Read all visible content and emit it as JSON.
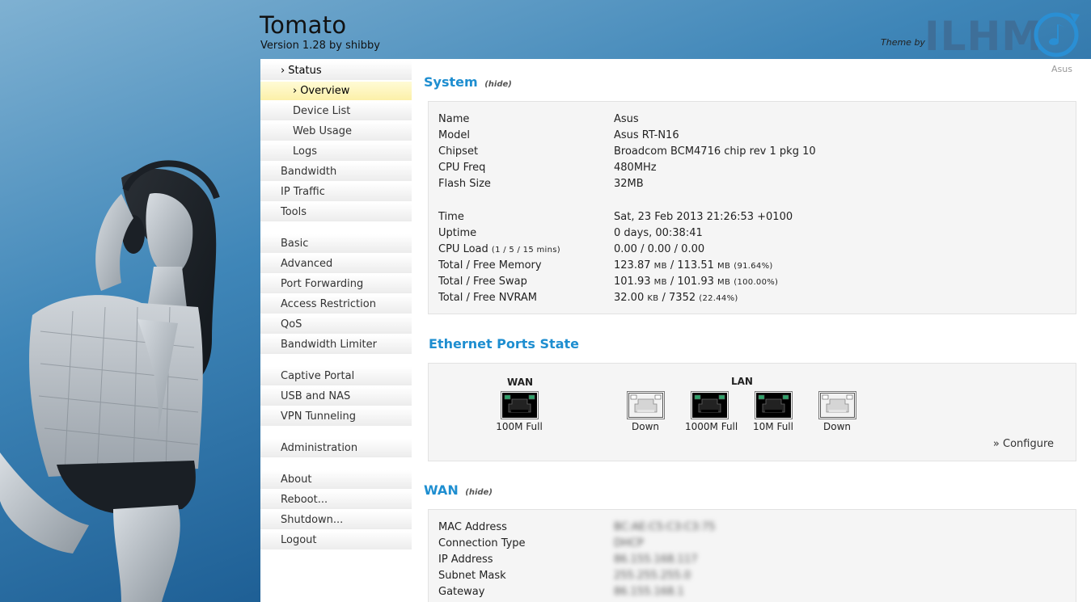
{
  "header": {
    "title": "Tomato",
    "version": "Version 1.28 by shibby",
    "theme_by": "Theme by",
    "theme_logo": "ILHM"
  },
  "router_name": "Asus",
  "nav": {
    "items": [
      {
        "label": "Status",
        "chev": "›",
        "sub": false,
        "state": "section"
      },
      {
        "label": "Overview",
        "chev": "›",
        "sub": true,
        "state": "active"
      },
      {
        "label": "Device List",
        "sub": true
      },
      {
        "label": "Web Usage",
        "sub": true
      },
      {
        "label": "Logs",
        "sub": true
      },
      {
        "label": "Bandwidth"
      },
      {
        "label": "IP Traffic"
      },
      {
        "label": "Tools"
      },
      {
        "label": "Basic"
      },
      {
        "label": "Advanced"
      },
      {
        "label": "Port Forwarding"
      },
      {
        "label": "Access Restriction"
      },
      {
        "label": "QoS"
      },
      {
        "label": "Bandwidth Limiter"
      },
      {
        "label": "Captive Portal"
      },
      {
        "label": "USB and NAS"
      },
      {
        "label": "VPN Tunneling"
      },
      {
        "label": "Administration"
      },
      {
        "label": "About"
      },
      {
        "label": "Reboot..."
      },
      {
        "label": "Shutdown..."
      },
      {
        "label": "Logout"
      }
    ]
  },
  "system": {
    "title": "System",
    "hide": "(hide)",
    "rows": [
      {
        "k": "Name",
        "v": "Asus"
      },
      {
        "k": "Model",
        "v": "Asus RT-N16"
      },
      {
        "k": "Chipset",
        "v": "Broadcom BCM4716 chip rev 1 pkg 10"
      },
      {
        "k": "CPU Freq",
        "v": "480MHz"
      },
      {
        "k": "Flash Size",
        "v": "32MB"
      },
      {
        "k": "Time",
        "v": "Sat, 23 Feb 2013 21:26:53 +0100"
      },
      {
        "k": "Uptime",
        "v": "0 days, 00:38:41"
      },
      {
        "k": "CPU Load",
        "k_small": "(1 / 5 / 15 mins)",
        "v": "0.00 / 0.00 / 0.00"
      },
      {
        "k": "Total / Free Memory",
        "v": "123.87",
        "v_u1": "MB",
        "v2": " / 113.51",
        "v_u2": "MB",
        "v_small": "(91.64%)"
      },
      {
        "k": "Total / Free Swap",
        "v": "101.93",
        "v_u1": "MB",
        "v2": " / 101.93",
        "v_u2": "MB",
        "v_small": "(100.00%)"
      },
      {
        "k": "Total / Free NVRAM",
        "v": "32.00",
        "v_u1": "KB",
        "v2": " / 7352",
        "v_u2": "",
        "v_small": "(22.44%)"
      }
    ]
  },
  "ethernet": {
    "title": "Ethernet Ports State",
    "wan_label": "WAN",
    "lan_label": "LAN",
    "ports": [
      {
        "name": "wan",
        "status": "100M Full",
        "active": true
      },
      {
        "name": "lan1",
        "status": "Down",
        "active": false
      },
      {
        "name": "lan2",
        "status": "1000M Full",
        "active": true
      },
      {
        "name": "lan3",
        "status": "10M Full",
        "active": true
      },
      {
        "name": "lan4",
        "status": "Down",
        "active": false
      }
    ],
    "configure": "» Configure"
  },
  "wan": {
    "title": "WAN",
    "hide": "(hide)",
    "rows": [
      {
        "k": "MAC Address",
        "v": "BC:AE:C5:C3:C3:75"
      },
      {
        "k": "Connection Type",
        "v": "DHCP"
      },
      {
        "k": "IP Address",
        "v": "86.155.168.117"
      },
      {
        "k": "Subnet Mask",
        "v": "255.255.255.0"
      },
      {
        "k": "Gateway",
        "v": "86.155.168.1"
      }
    ]
  },
  "colors": {
    "accent": "#1e8ed0",
    "nav_active": "#fcf0a8",
    "port_led": "#2ea36b"
  }
}
